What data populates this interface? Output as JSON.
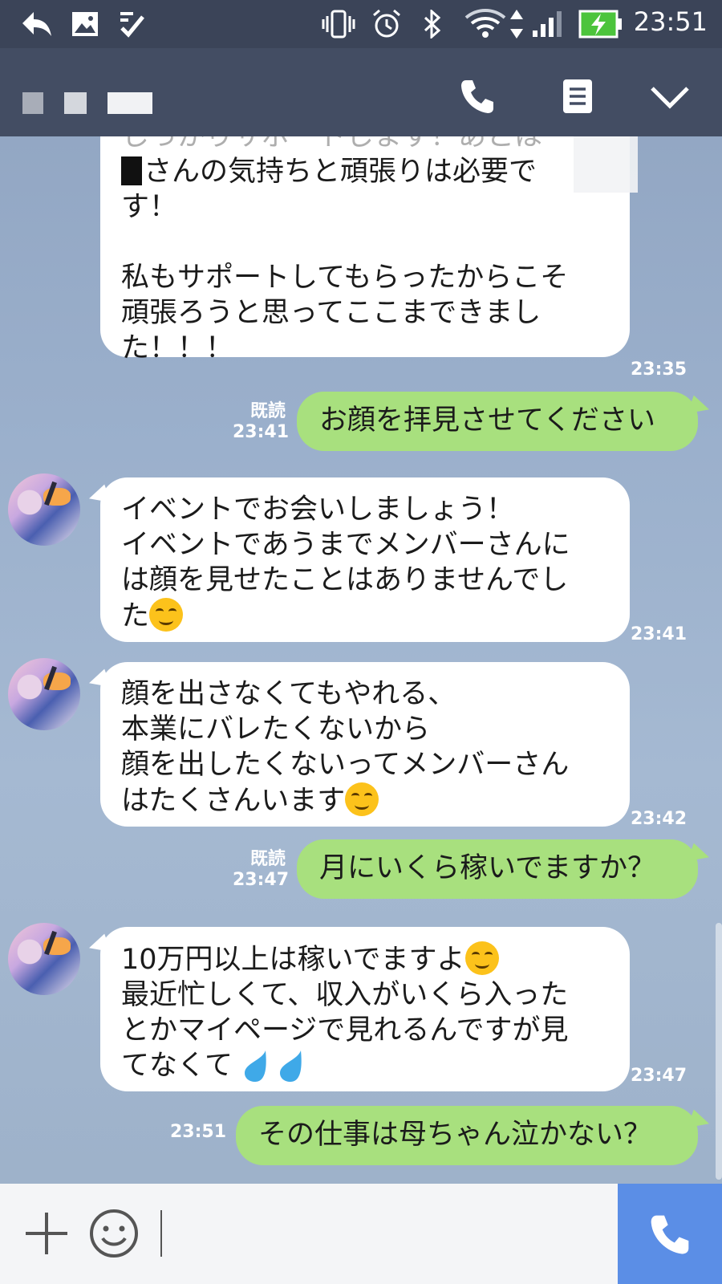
{
  "status_bar": {
    "time": "23:51",
    "icons": [
      "reply-icon",
      "image-icon",
      "check-list-icon",
      "vibrate-icon",
      "alarm-icon",
      "bluetooth-icon",
      "wifi-icon",
      "signal-icon",
      "battery-charging-icon"
    ]
  },
  "header": {
    "icons": [
      "call-icon",
      "notes-icon",
      "chevron-down-icon"
    ]
  },
  "colors": {
    "header": "#434d63",
    "status_bar": "#3b4458",
    "outgoing_bubble": "#a8e07e",
    "incoming_bubble": "#ffffff",
    "call_button": "#5b8ee6"
  },
  "messages": [
    {
      "direction": "in",
      "lines": [
        "しっかりサポートします！あとは",
        "さんの気持ちと頑張りは必要で",
        "す！",
        "",
        "私もサポートしてもらったからこそ",
        "頑張ろうと思ってここまできまし",
        "た！！！"
      ],
      "time": "23:35"
    },
    {
      "direction": "out",
      "text": "お顔を拝見させてください",
      "read": "既読",
      "time": "23:41"
    },
    {
      "direction": "in",
      "lines": [
        "イベントでお会いしましょう！",
        "イベントであうまでメンバーさんに",
        "は顔を見せたことはありませんでし",
        "た"
      ],
      "emoji": "smiling-face",
      "time": "23:41"
    },
    {
      "direction": "in",
      "lines": [
        "顔を出さなくてもやれる、",
        "本業にバレたくないから",
        "顔を出したくないってメンバーさん",
        "はたくさんいます"
      ],
      "emoji": "smiling-face",
      "time": "23:42"
    },
    {
      "direction": "out",
      "text": "月にいくら稼いでますか？",
      "read": "既読",
      "time": "23:47"
    },
    {
      "direction": "in",
      "lines": [
        "10万円以上は稼いでますよ",
        "最近忙しくて、収入がいくら入った",
        "とかマイページで見れるんですが見",
        "てなくて"
      ],
      "emoji": "sweat-drops",
      "time": "23:47"
    },
    {
      "direction": "out",
      "text": "その仕事は母ちゃん泣かない？",
      "time": "23:51"
    }
  ],
  "input_bar": {
    "icons": [
      "plus-icon",
      "emoji-icon",
      "call-icon"
    ]
  }
}
